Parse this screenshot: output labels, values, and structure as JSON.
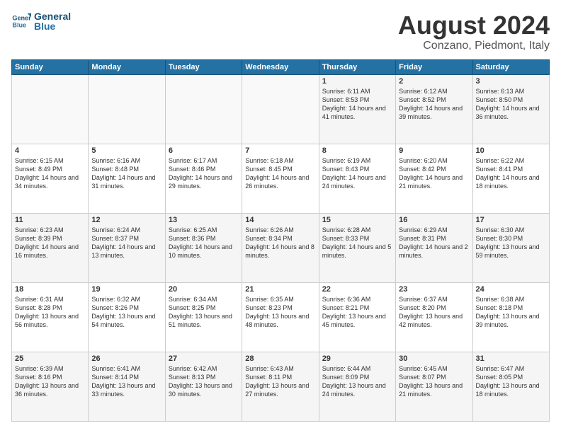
{
  "header": {
    "logo_general": "General",
    "logo_blue": "Blue",
    "month_title": "August 2024",
    "location": "Conzano, Piedmont, Italy"
  },
  "weekdays": [
    "Sunday",
    "Monday",
    "Tuesday",
    "Wednesday",
    "Thursday",
    "Friday",
    "Saturday"
  ],
  "weeks": [
    [
      {
        "day": "",
        "info": ""
      },
      {
        "day": "",
        "info": ""
      },
      {
        "day": "",
        "info": ""
      },
      {
        "day": "",
        "info": ""
      },
      {
        "day": "1",
        "info": "Sunrise: 6:11 AM\nSunset: 8:53 PM\nDaylight: 14 hours and 41 minutes."
      },
      {
        "day": "2",
        "info": "Sunrise: 6:12 AM\nSunset: 8:52 PM\nDaylight: 14 hours and 39 minutes."
      },
      {
        "day": "3",
        "info": "Sunrise: 6:13 AM\nSunset: 8:50 PM\nDaylight: 14 hours and 36 minutes."
      }
    ],
    [
      {
        "day": "4",
        "info": "Sunrise: 6:15 AM\nSunset: 8:49 PM\nDaylight: 14 hours and 34 minutes."
      },
      {
        "day": "5",
        "info": "Sunrise: 6:16 AM\nSunset: 8:48 PM\nDaylight: 14 hours and 31 minutes."
      },
      {
        "day": "6",
        "info": "Sunrise: 6:17 AM\nSunset: 8:46 PM\nDaylight: 14 hours and 29 minutes."
      },
      {
        "day": "7",
        "info": "Sunrise: 6:18 AM\nSunset: 8:45 PM\nDaylight: 14 hours and 26 minutes."
      },
      {
        "day": "8",
        "info": "Sunrise: 6:19 AM\nSunset: 8:43 PM\nDaylight: 14 hours and 24 minutes."
      },
      {
        "day": "9",
        "info": "Sunrise: 6:20 AM\nSunset: 8:42 PM\nDaylight: 14 hours and 21 minutes."
      },
      {
        "day": "10",
        "info": "Sunrise: 6:22 AM\nSunset: 8:41 PM\nDaylight: 14 hours and 18 minutes."
      }
    ],
    [
      {
        "day": "11",
        "info": "Sunrise: 6:23 AM\nSunset: 8:39 PM\nDaylight: 14 hours and 16 minutes."
      },
      {
        "day": "12",
        "info": "Sunrise: 6:24 AM\nSunset: 8:37 PM\nDaylight: 14 hours and 13 minutes."
      },
      {
        "day": "13",
        "info": "Sunrise: 6:25 AM\nSunset: 8:36 PM\nDaylight: 14 hours and 10 minutes."
      },
      {
        "day": "14",
        "info": "Sunrise: 6:26 AM\nSunset: 8:34 PM\nDaylight: 14 hours and 8 minutes."
      },
      {
        "day": "15",
        "info": "Sunrise: 6:28 AM\nSunset: 8:33 PM\nDaylight: 14 hours and 5 minutes."
      },
      {
        "day": "16",
        "info": "Sunrise: 6:29 AM\nSunset: 8:31 PM\nDaylight: 14 hours and 2 minutes."
      },
      {
        "day": "17",
        "info": "Sunrise: 6:30 AM\nSunset: 8:30 PM\nDaylight: 13 hours and 59 minutes."
      }
    ],
    [
      {
        "day": "18",
        "info": "Sunrise: 6:31 AM\nSunset: 8:28 PM\nDaylight: 13 hours and 56 minutes."
      },
      {
        "day": "19",
        "info": "Sunrise: 6:32 AM\nSunset: 8:26 PM\nDaylight: 13 hours and 54 minutes."
      },
      {
        "day": "20",
        "info": "Sunrise: 6:34 AM\nSunset: 8:25 PM\nDaylight: 13 hours and 51 minutes."
      },
      {
        "day": "21",
        "info": "Sunrise: 6:35 AM\nSunset: 8:23 PM\nDaylight: 13 hours and 48 minutes."
      },
      {
        "day": "22",
        "info": "Sunrise: 6:36 AM\nSunset: 8:21 PM\nDaylight: 13 hours and 45 minutes."
      },
      {
        "day": "23",
        "info": "Sunrise: 6:37 AM\nSunset: 8:20 PM\nDaylight: 13 hours and 42 minutes."
      },
      {
        "day": "24",
        "info": "Sunrise: 6:38 AM\nSunset: 8:18 PM\nDaylight: 13 hours and 39 minutes."
      }
    ],
    [
      {
        "day": "25",
        "info": "Sunrise: 6:39 AM\nSunset: 8:16 PM\nDaylight: 13 hours and 36 minutes."
      },
      {
        "day": "26",
        "info": "Sunrise: 6:41 AM\nSunset: 8:14 PM\nDaylight: 13 hours and 33 minutes."
      },
      {
        "day": "27",
        "info": "Sunrise: 6:42 AM\nSunset: 8:13 PM\nDaylight: 13 hours and 30 minutes."
      },
      {
        "day": "28",
        "info": "Sunrise: 6:43 AM\nSunset: 8:11 PM\nDaylight: 13 hours and 27 minutes."
      },
      {
        "day": "29",
        "info": "Sunrise: 6:44 AM\nSunset: 8:09 PM\nDaylight: 13 hours and 24 minutes."
      },
      {
        "day": "30",
        "info": "Sunrise: 6:45 AM\nSunset: 8:07 PM\nDaylight: 13 hours and 21 minutes."
      },
      {
        "day": "31",
        "info": "Sunrise: 6:47 AM\nSunset: 8:05 PM\nDaylight: 13 hours and 18 minutes."
      }
    ]
  ]
}
